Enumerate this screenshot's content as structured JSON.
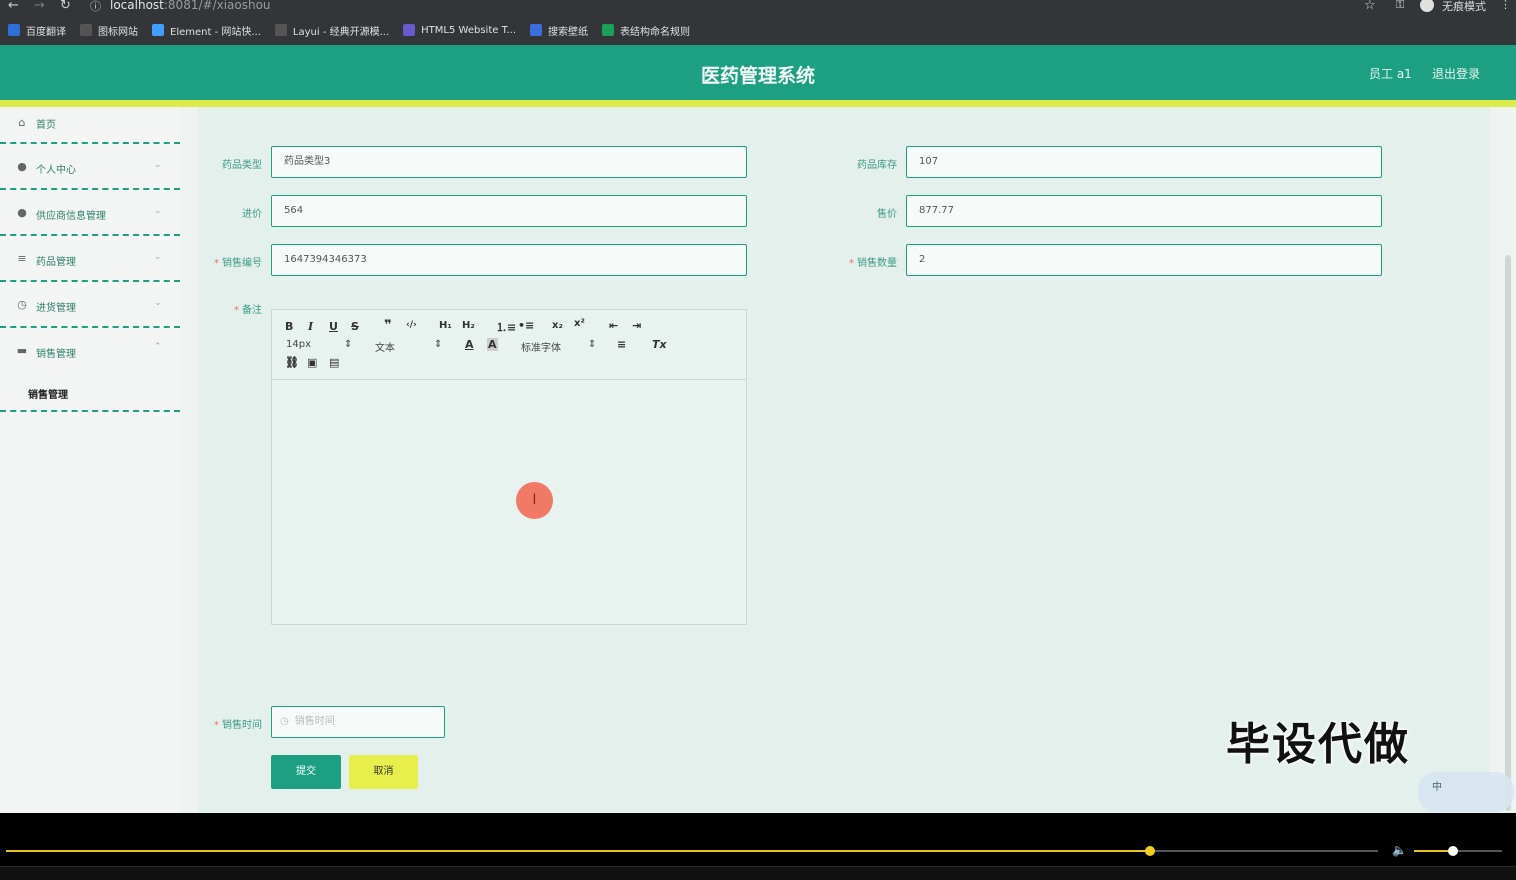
{
  "browser": {
    "url_host": "localhost",
    "url_rest": ":8081/#/xiaoshou",
    "incognito_label": "无痕模式",
    "bookmarks": [
      {
        "label": "百度翻译",
        "icon": "baidu-translate-icon",
        "color": "#2f6fd8"
      },
      {
        "label": "图标网站",
        "icon": "flag-icon",
        "color": "#555"
      },
      {
        "label": "Element - 网站快...",
        "icon": "element-icon",
        "color": "#409eff"
      },
      {
        "label": "Layui - 经典开源模...",
        "icon": "layui-icon",
        "color": "#555"
      },
      {
        "label": "HTML5 Website T...",
        "icon": "html5-icon",
        "color": "#6a5acd"
      },
      {
        "label": "搜索壁纸",
        "icon": "wallpaper-icon",
        "color": "#3b6fe0"
      },
      {
        "label": "表结构命名规则",
        "icon": "table-icon",
        "color": "#1a9f5a"
      }
    ]
  },
  "header": {
    "title": "医药管理系统",
    "user": "员工 a1",
    "logout": "退出登录",
    "color": "#1d9f82",
    "band_color": "#dceb4a"
  },
  "sidebar": {
    "items": [
      {
        "label": "首页",
        "icon": "home-icon",
        "has_chevron": false
      },
      {
        "label": "个人中心",
        "icon": "user-icon",
        "has_chevron": true
      },
      {
        "label": "供应商信息管理",
        "icon": "user-icon",
        "has_chevron": true
      },
      {
        "label": "药品管理",
        "icon": "menu-icon",
        "has_chevron": true
      },
      {
        "label": "进货管理",
        "icon": "dashboard-icon",
        "has_chevron": true
      },
      {
        "label": "销售管理",
        "icon": "briefcase-icon",
        "has_chevron": true,
        "expanded": true
      }
    ],
    "subitem": "销售管理"
  },
  "form": {
    "drug_type_label": "药品类型",
    "drug_type_value": "药品类型3",
    "stock_label": "药品库存",
    "stock_value": "107",
    "purchase_price_label": "进价",
    "purchase_price_value": "564",
    "sale_price_label": "售价",
    "sale_price_value": "877.77",
    "sale_no_label": "销售编号",
    "sale_no_value": "1647394346373",
    "sale_qty_label": "销售数量",
    "sale_qty_value": "2",
    "remark_label": "备注",
    "sale_time_label": "销售时间",
    "sale_time_placeholder": "销售时间",
    "submit": "提交",
    "cancel": "取消"
  },
  "editor": {
    "font_size": "14px",
    "paragraph": "文本",
    "font_family": "标准字体"
  },
  "overlay": {
    "watermark": "毕设代做",
    "ime": "中"
  }
}
